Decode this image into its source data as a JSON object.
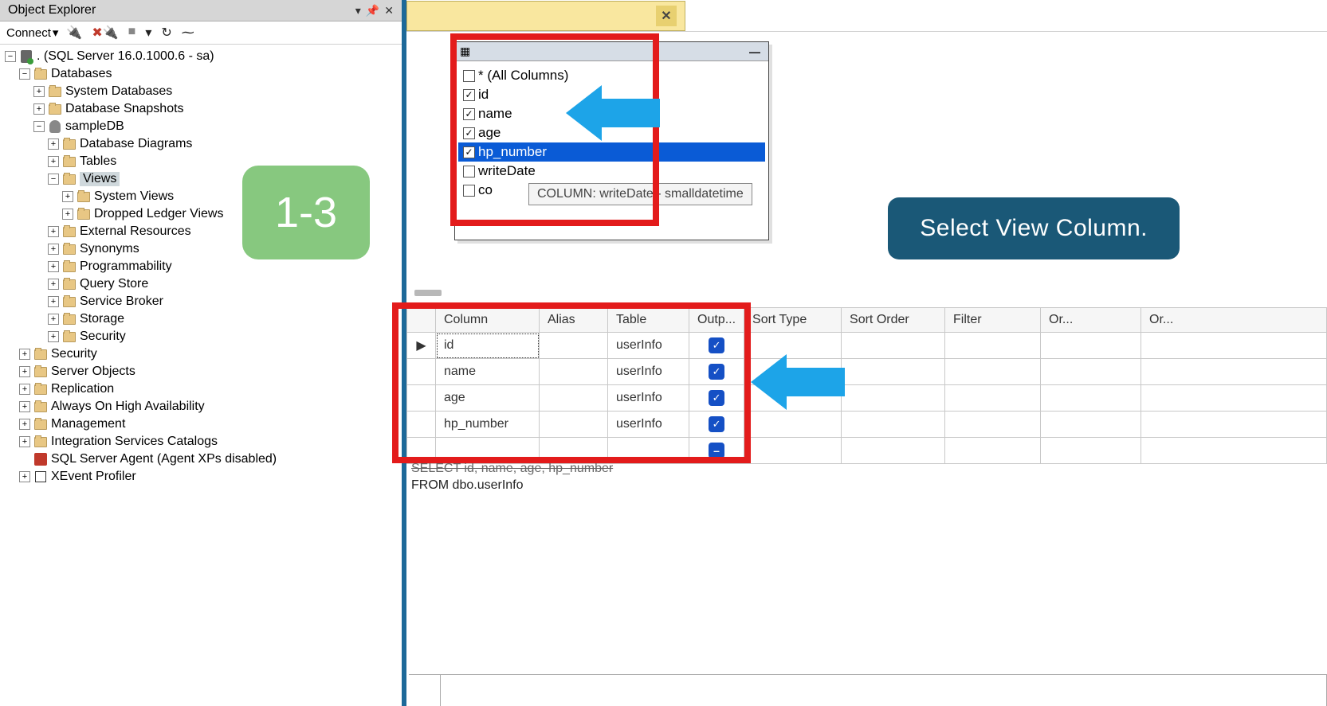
{
  "panel": {
    "title": "Object Explorer",
    "connect_label": "Connect"
  },
  "tree": {
    "root": ". (SQL Server 16.0.1000.6 - sa)",
    "databases": "Databases",
    "system_databases": "System Databases",
    "database_snapshots": "Database Snapshots",
    "sampledb": "sampleDB",
    "db_diagrams": "Database Diagrams",
    "tables": "Tables",
    "views": "Views",
    "system_views": "System Views",
    "dropped_ledger_views": "Dropped Ledger Views",
    "external_resources": "External Resources",
    "synonyms": "Synonyms",
    "programmability": "Programmability",
    "query_store": "Query Store",
    "service_broker": "Service Broker",
    "storage": "Storage",
    "security_inner": "Security",
    "security": "Security",
    "server_objects": "Server Objects",
    "replication": "Replication",
    "always_on": "Always On High Availability",
    "management": "Management",
    "integration": "Integration Services Catalogs",
    "agent": "SQL Server Agent (Agent XPs disabled)",
    "xevent": "XEvent Profiler"
  },
  "step_badge": "1-3",
  "table_selector": {
    "columns": [
      {
        "name": "* (All Columns)",
        "checked": false
      },
      {
        "name": "id",
        "checked": true
      },
      {
        "name": "name",
        "checked": true
      },
      {
        "name": "age",
        "checked": true
      },
      {
        "name": "hp_number",
        "checked": true,
        "highlighted": true
      },
      {
        "name": "writeDate",
        "checked": false
      },
      {
        "name": "co",
        "checked": false
      }
    ],
    "tooltip": "COLUMN: writeDate - smalldatetime"
  },
  "callout_text": "Select View Column.",
  "grid": {
    "headers": {
      "column": "Column",
      "alias": "Alias",
      "table": "Table",
      "output": "Outp...",
      "sort_type": "Sort Type",
      "sort_order": "Sort Order",
      "filter": "Filter",
      "or1": "Or...",
      "or2": "Or..."
    },
    "rows": [
      {
        "column": "id",
        "table": "userInfo",
        "output": true,
        "current": true
      },
      {
        "column": "name",
        "table": "userInfo",
        "output": true
      },
      {
        "column": "age",
        "table": "userInfo",
        "output": true
      },
      {
        "column": "hp_number",
        "table": "userInfo",
        "output": true
      }
    ]
  },
  "sql": {
    "line1": "SELECT id, name, age, hp_number",
    "line2": "FROM   dbo.userInfo"
  }
}
